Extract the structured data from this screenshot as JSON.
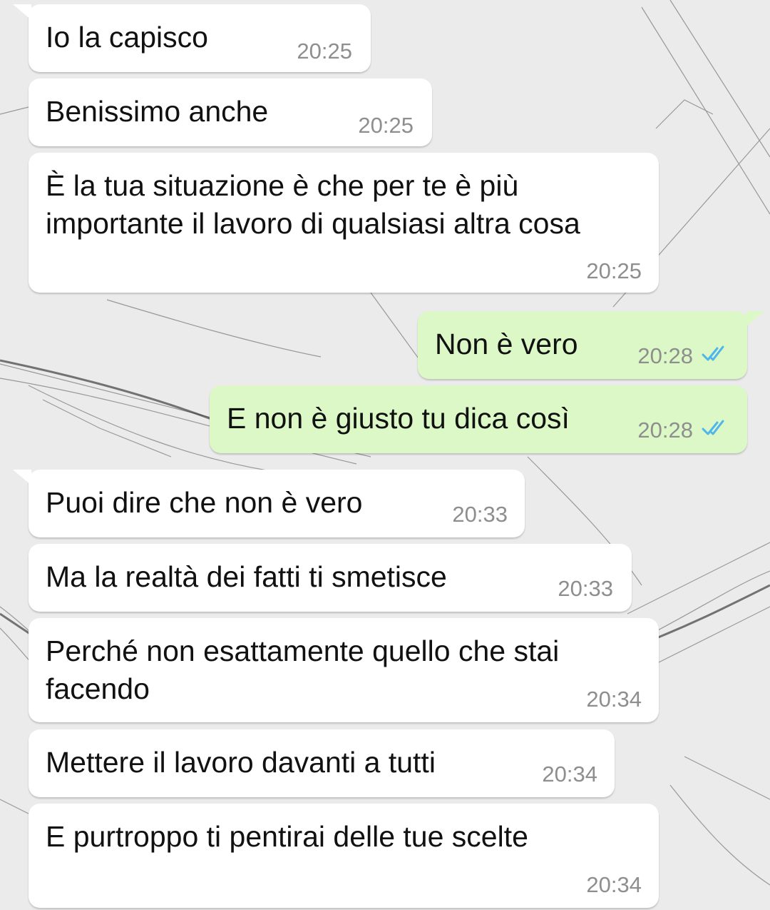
{
  "chat": {
    "messages": [
      {
        "direction": "incoming",
        "text": "Io la capisco",
        "time": "20:25"
      },
      {
        "direction": "incoming",
        "text": "Benissimo anche",
        "time": "20:25"
      },
      {
        "direction": "incoming",
        "text": "È la tua situazione è che per te è più\nimportante il lavoro di qualsiasi altra cosa",
        "time": "20:25"
      },
      {
        "direction": "outgoing",
        "text": "Non è vero",
        "time": "20:28",
        "status": "read-double-check-icon"
      },
      {
        "direction": "outgoing",
        "text": "E non è giusto tu dica così",
        "time": "20:28",
        "status": "read-double-check-icon"
      },
      {
        "direction": "incoming",
        "text": "Puoi dire che non è vero",
        "time": "20:33"
      },
      {
        "direction": "incoming",
        "text": "Ma la realtà dei fatti ti smetisce",
        "time": "20:33"
      },
      {
        "direction": "incoming",
        "text": "Perché non esattamente quello che stai\nfacendo",
        "time": "20:34"
      },
      {
        "direction": "incoming",
        "text": "Mettere il lavoro davanti a tutti",
        "time": "20:34"
      },
      {
        "direction": "incoming",
        "text": "E purtroppo ti pentirai delle tue scelte",
        "time": "20:34"
      }
    ]
  },
  "colors": {
    "incoming_bubble": "#ffffff",
    "outgoing_bubble": "#dcf8c6",
    "read_check": "#4fb6ec",
    "timestamp": "#8e8e8e"
  }
}
